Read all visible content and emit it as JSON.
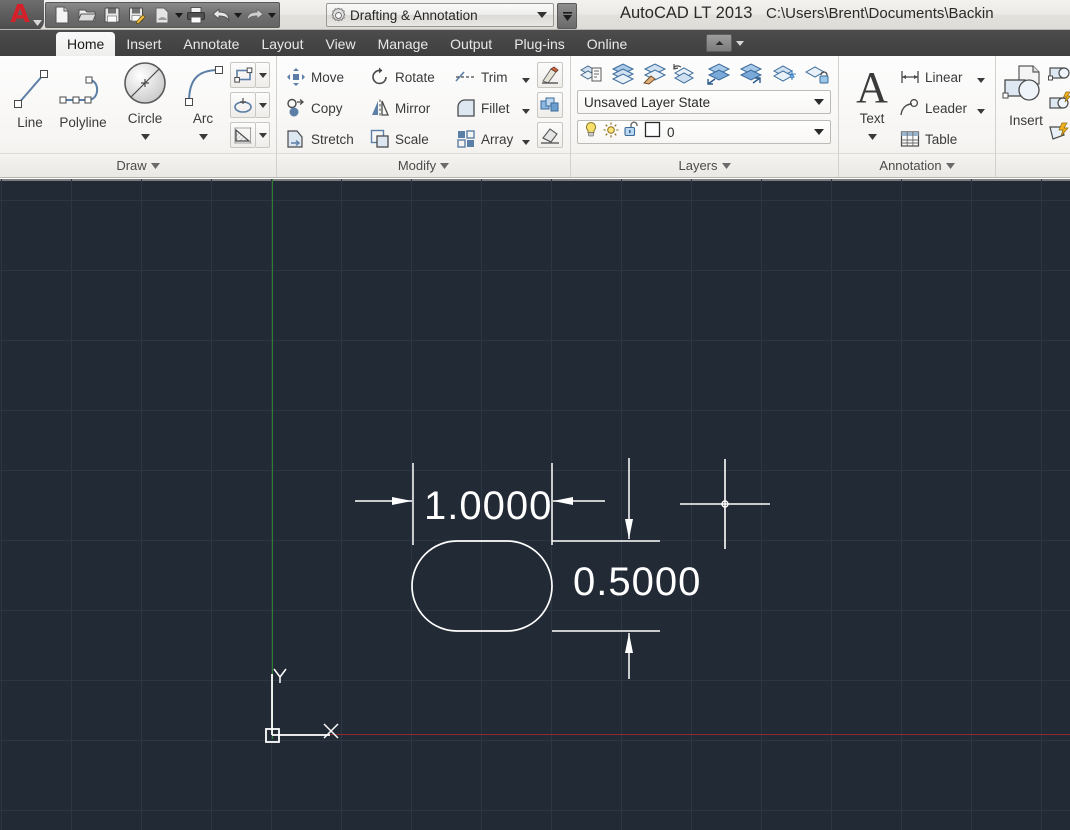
{
  "titlebar": {
    "app_menu_icon": "autocad-a-logo-icon",
    "quick_access": [
      {
        "name": "new-file-button",
        "icon": "new-document-icon"
      },
      {
        "name": "open-file-button",
        "icon": "open-folder-icon"
      },
      {
        "name": "save-button",
        "icon": "floppy-disk-icon"
      },
      {
        "name": "save-as-button",
        "icon": "floppy-disk-pencil-icon"
      },
      {
        "name": "plot-preview-button",
        "icon": "plot-preview-icon"
      },
      {
        "name": "plot-button",
        "icon": "printer-icon"
      },
      {
        "name": "undo-button",
        "icon": "undo-arrow-icon"
      },
      {
        "name": "redo-button",
        "icon": "redo-arrow-icon"
      }
    ],
    "workspace": {
      "icon": "gear-icon",
      "value": "Drafting & Annotation",
      "caret": "chevron-down-icon"
    },
    "workspace_more_icon": "double-chevron-down-icon",
    "app_title": "AutoCAD LT 2013",
    "document_path": "C:\\Users\\Brent\\Documents\\Backin"
  },
  "tabs": [
    {
      "label": "Home",
      "active": true
    },
    {
      "label": "Insert",
      "active": false
    },
    {
      "label": "Annotate",
      "active": false
    },
    {
      "label": "Layout",
      "active": false
    },
    {
      "label": "View",
      "active": false
    },
    {
      "label": "Manage",
      "active": false
    },
    {
      "label": "Output",
      "active": false
    },
    {
      "label": "Plug-ins",
      "active": false
    },
    {
      "label": "Online",
      "active": false
    }
  ],
  "tab_tools_icon": "minimize-ribbon-icon",
  "panels": {
    "draw": {
      "title": "Draw",
      "title_caret": "chevron-down-icon",
      "line": {
        "label": "Line",
        "icon": "line-tool-icon"
      },
      "polyline": {
        "label": "Polyline",
        "icon": "polyline-tool-icon"
      },
      "circle": {
        "label": "Circle",
        "icon": "circle-tool-icon",
        "caret": "chevron-down-icon"
      },
      "arc": {
        "label": "Arc",
        "icon": "arc-tool-icon",
        "caret": "chevron-down-icon"
      },
      "rectangle": {
        "icon": "rectangle-tool-icon",
        "caret": "chevron-down-icon"
      },
      "ellipse": {
        "icon": "ellipse-tool-icon",
        "caret": "chevron-down-icon"
      },
      "hatch": {
        "icon": "hatch-tool-icon",
        "caret": "chevron-down-icon"
      }
    },
    "modify": {
      "title": "Modify",
      "title_caret": "chevron-down-icon",
      "move": {
        "label": "Move",
        "icon": "move-tool-icon"
      },
      "rotate": {
        "label": "Rotate",
        "icon": "rotate-tool-icon"
      },
      "trim": {
        "label": "Trim",
        "icon": "trim-tool-icon",
        "caret": "chevron-down-icon"
      },
      "copy": {
        "label": "Copy",
        "icon": "copy-tool-icon"
      },
      "mirror": {
        "label": "Mirror",
        "icon": "mirror-tool-icon"
      },
      "fillet": {
        "label": "Fillet",
        "icon": "fillet-tool-icon",
        "caret": "chevron-down-icon"
      },
      "stretch": {
        "label": "Stretch",
        "icon": "stretch-tool-icon"
      },
      "scale": {
        "label": "Scale",
        "icon": "scale-tool-icon"
      },
      "array": {
        "label": "Array",
        "icon": "array-tool-icon",
        "caret": "chevron-down-icon"
      },
      "match_properties": {
        "icon": "match-properties-brush-icon"
      },
      "explode": {
        "icon": "explode-tool-icon"
      },
      "erase": {
        "icon": "erase-tool-icon"
      }
    },
    "layers": {
      "title": "Layers",
      "title_caret": "chevron-down-icon",
      "tools": [
        {
          "name": "layer-properties-button",
          "icon": "layer-properties-icon"
        },
        {
          "name": "layer-make-current-button",
          "icon": "layer-stack-icon"
        },
        {
          "name": "layer-match-button",
          "icon": "layer-match-brush-icon"
        },
        {
          "name": "layer-previous-button",
          "icon": "layer-previous-icon"
        },
        {
          "name": "layer-off-button",
          "icon": "layer-off-icon"
        },
        {
          "name": "layer-isolate-button",
          "icon": "layer-isolate-icon"
        },
        {
          "name": "layer-freeze-button",
          "icon": "layer-freeze-icon"
        },
        {
          "name": "layer-lock-button",
          "icon": "layer-lock-icon"
        }
      ],
      "layer_state": {
        "value": "Unsaved Layer State",
        "caret": "chevron-down-icon"
      },
      "current_layer": {
        "value": "0",
        "caret": "chevron-down-icon",
        "on_icon": "lightbulb-icon",
        "thaw_icon": "sun-icon",
        "unlock_icon": "open-padlock-icon",
        "color_swatch": "#ffffff"
      }
    },
    "annotation": {
      "title": "Annotation",
      "title_caret": "chevron-down-icon",
      "text": {
        "label": "Text",
        "icon": "text-letter-a-icon",
        "caret": "chevron-down-icon"
      },
      "linear": {
        "label": "Linear",
        "icon": "linear-dimension-icon",
        "caret": "chevron-down-icon"
      },
      "leader": {
        "label": "Leader",
        "icon": "leader-dimension-icon",
        "caret": "chevron-down-icon"
      },
      "table": {
        "label": "Table",
        "icon": "table-grid-icon"
      }
    },
    "insert": {
      "title": "",
      "block": {
        "label": "Insert",
        "icon": "insert-block-icon"
      },
      "tools": [
        {
          "name": "edit-attribute-button",
          "icon": "edit-attribute-icon"
        },
        {
          "name": "define-attributes-button",
          "icon": "define-attributes-icon"
        },
        {
          "name": "clip-button",
          "icon": "clip-icon"
        }
      ]
    }
  },
  "canvas": {
    "background_color": "#222a35",
    "grid_color": "#2d3643",
    "geometry_color": "#ffffff",
    "x_axis_color": "#8b2b2b",
    "y_axis_color": "#2e7d32",
    "horizontal_dimension_value": "1.0000",
    "vertical_dimension_value": "0.5000",
    "ucs_x_label": "X",
    "ucs_y_label": "Y",
    "shape": "rounded-slot",
    "cursor": "crosshair-cursor"
  }
}
